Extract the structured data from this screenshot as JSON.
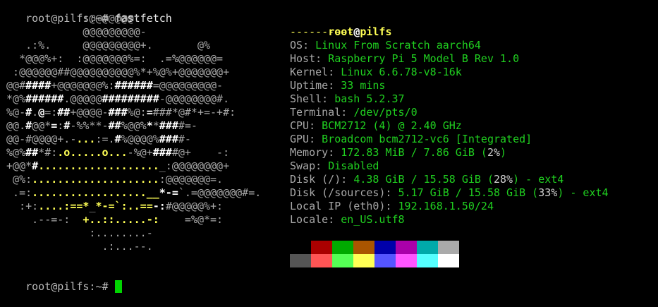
{
  "prompt": {
    "text": "root@pilfs:~#",
    "command": "fastfetch"
  },
  "logo_rows": [
    [
      [
        "g",
        "             :@@@@@@@:"
      ]
    ],
    [
      [
        "g",
        "             @@@@@@@@@-"
      ]
    ],
    [
      [
        "g",
        "    .:%.     @@@@@@@@@+.       @%"
      ]
    ],
    [
      [
        "g",
        "   *@@@%+:  :@@@@@@@%=:  .=%@@@@@@="
      ]
    ],
    [
      [
        "g",
        "  :@@@@@@##@@@@@@@@@@%*+%@%+@@@@@@@+"
      ]
    ],
    [
      [
        "g",
        " @@#"
      ],
      [
        "w",
        "####"
      ],
      [
        "g",
        "+@@@@@@@%:"
      ],
      [
        "w",
        "######"
      ],
      [
        "g",
        "=@@@@@@@@@-"
      ]
    ],
    [
      [
        "g",
        " *@%"
      ],
      [
        "w",
        "######"
      ],
      [
        "g",
        ".@@@@@"
      ],
      [
        "w",
        "#########"
      ],
      [
        "g",
        "-@@@@@@@@#."
      ]
    ],
    [
      [
        "g",
        " %@-"
      ],
      [
        "w",
        "#"
      ],
      [
        "g",
        "."
      ],
      [
        "w",
        "@"
      ],
      [
        "g",
        "=:"
      ],
      [
        "w",
        "##"
      ],
      [
        "g",
        "+@@@@-"
      ],
      [
        "w",
        "###"
      ],
      [
        "g",
        "%@:"
      ],
      [
        "w",
        "="
      ],
      [
        "g",
        "###*@#*+=-+#:"
      ]
    ],
    [
      [
        "g",
        " @@."
      ],
      [
        "w",
        "#"
      ],
      [
        "g",
        "@@*"
      ],
      [
        "w",
        "="
      ],
      [
        "g",
        ":"
      ],
      [
        "w",
        "#"
      ],
      [
        "g",
        "-%%**-"
      ],
      [
        "w",
        "##"
      ],
      [
        "g",
        "%@@%"
      ],
      [
        "w",
        "*"
      ],
      [
        "g",
        "*"
      ],
      [
        "w",
        "###"
      ],
      [
        "g",
        "#=-"
      ]
    ],
    [
      [
        "g",
        " @@-#@@@@+.-"
      ],
      [
        "y",
        "..."
      ],
      [
        "g",
        ":=."
      ],
      [
        "w",
        "#"
      ],
      [
        "g",
        "%@@@@%"
      ],
      [
        "w",
        "###"
      ],
      [
        "g",
        "#-"
      ]
    ],
    [
      [
        "g",
        " %@%"
      ],
      [
        "w",
        "##"
      ],
      [
        "g",
        "*#:"
      ],
      [
        "y",
        ".o.....o..."
      ],
      [
        "g",
        "-%@+"
      ],
      [
        "w",
        "###"
      ],
      [
        "g",
        "#@+    -:"
      ]
    ],
    [
      [
        "g",
        " +@@*"
      ],
      [
        "w",
        "#"
      ],
      [
        "y",
        "..................."
      ],
      [
        "g",
        "_:@@@@@@@@+"
      ]
    ],
    [
      [
        "g",
        "  @%:"
      ],
      [
        "y",
        "...................."
      ],
      [
        "g",
        ":@@@@@@@=."
      ]
    ],
    [
      [
        "g",
        "  .=:"
      ],
      [
        "y",
        "..................__"
      ],
      [
        "w",
        "*-="
      ],
      [
        "g",
        "`.=@@@@@@@#=."
      ]
    ],
    [
      [
        "g",
        "   :+:"
      ],
      [
        "y",
        "....:==*"
      ],
      [
        "g",
        "_"
      ],
      [
        "y",
        "*-=`:..=="
      ],
      [
        "w",
        "-:"
      ],
      [
        "g",
        "#@@@@@%+:"
      ]
    ],
    [
      [
        "g",
        "     .--=-:  "
      ],
      [
        "y",
        "+..::.....-:"
      ],
      [
        "g",
        "    =%@*=:"
      ]
    ],
    [
      [
        "g",
        "              :........-"
      ]
    ],
    [
      [
        "g",
        "                .:...--."
      ]
    ]
  ],
  "info": {
    "user": "root",
    "at": "@",
    "host": "pilfs",
    "separator": "----------",
    "rows": [
      {
        "key": "OS",
        "value": "Linux From Scratch aarch64"
      },
      {
        "key": "Host",
        "value": "Raspberry Pi 5 Model B Rev 1.0"
      },
      {
        "key": "Kernel",
        "value": "Linux 6.6.78-v8-16k"
      },
      {
        "key": "Uptime",
        "value": "33 mins"
      },
      {
        "key": "Shell",
        "value": "bash 5.2.37"
      },
      {
        "key": "Terminal",
        "value": "/dev/pts/0"
      },
      {
        "key": "CPU",
        "value": "BCM2712 (4) @ 2.40 GHz"
      },
      {
        "key": "GPU",
        "value": "Broadcom bcm2712-vc6 [Integrated]"
      },
      {
        "key": "Memory",
        "value": "172.83 MiB / 7.86 GiB",
        "pct": "2%"
      },
      {
        "key": "Swap",
        "value": "Disabled"
      },
      {
        "key": "Disk (/)",
        "value": "4.38 GiB / 15.58 GiB",
        "pct": "28%",
        "suffix": " - ext4"
      },
      {
        "key": "Disk (/sources)",
        "value": "5.17 GiB / 15.58 GiB",
        "pct": "33%",
        "suffix": " - ext4"
      },
      {
        "key": "Local IP (eth0)",
        "value": "192.168.1.50/24"
      },
      {
        "key": "Locale",
        "value": "en_US.utf8"
      }
    ]
  },
  "palette": {
    "row1": [
      "#000000",
      "#aa0000",
      "#00aa00",
      "#aa5500",
      "#0000aa",
      "#aa00aa",
      "#00aaaa",
      "#aaaaaa"
    ],
    "row2": [
      "#555555",
      "#ff5555",
      "#55ff55",
      "#ffff55",
      "#5555ff",
      "#ff55ff",
      "#55ffff",
      "#ffffff"
    ]
  },
  "final_prompt": "root@pilfs:~#"
}
